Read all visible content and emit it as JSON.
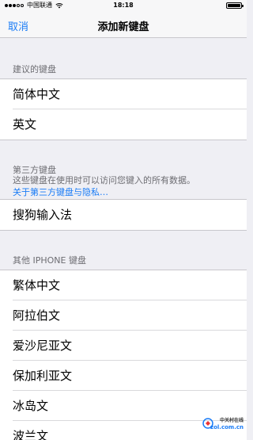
{
  "status_bar": {
    "carrier": "中国联通",
    "time": "18:18"
  },
  "nav": {
    "cancel_label": "取消",
    "title": "添加新键盘"
  },
  "suggested": {
    "header": "建议的键盘",
    "items": [
      "简体中文",
      "英文"
    ]
  },
  "third_party": {
    "header": "第三方键盘",
    "note": "这些键盘在使用时可以访问您键入的所有数据。",
    "link": "关于第三方键盘与隐私…",
    "items": [
      "搜狗输入法"
    ]
  },
  "other": {
    "header": "其他 IPHONE 键盘",
    "items": [
      "繁体中文",
      "阿拉伯文",
      "爱沙尼亚文",
      "保加利亚文",
      "冰岛文",
      "波兰文"
    ]
  },
  "watermark": {
    "top": "中关村在线",
    "bottom": "zol.com.cn"
  },
  "colors": {
    "accent": "#1a7cf6",
    "background": "#efeff4"
  }
}
